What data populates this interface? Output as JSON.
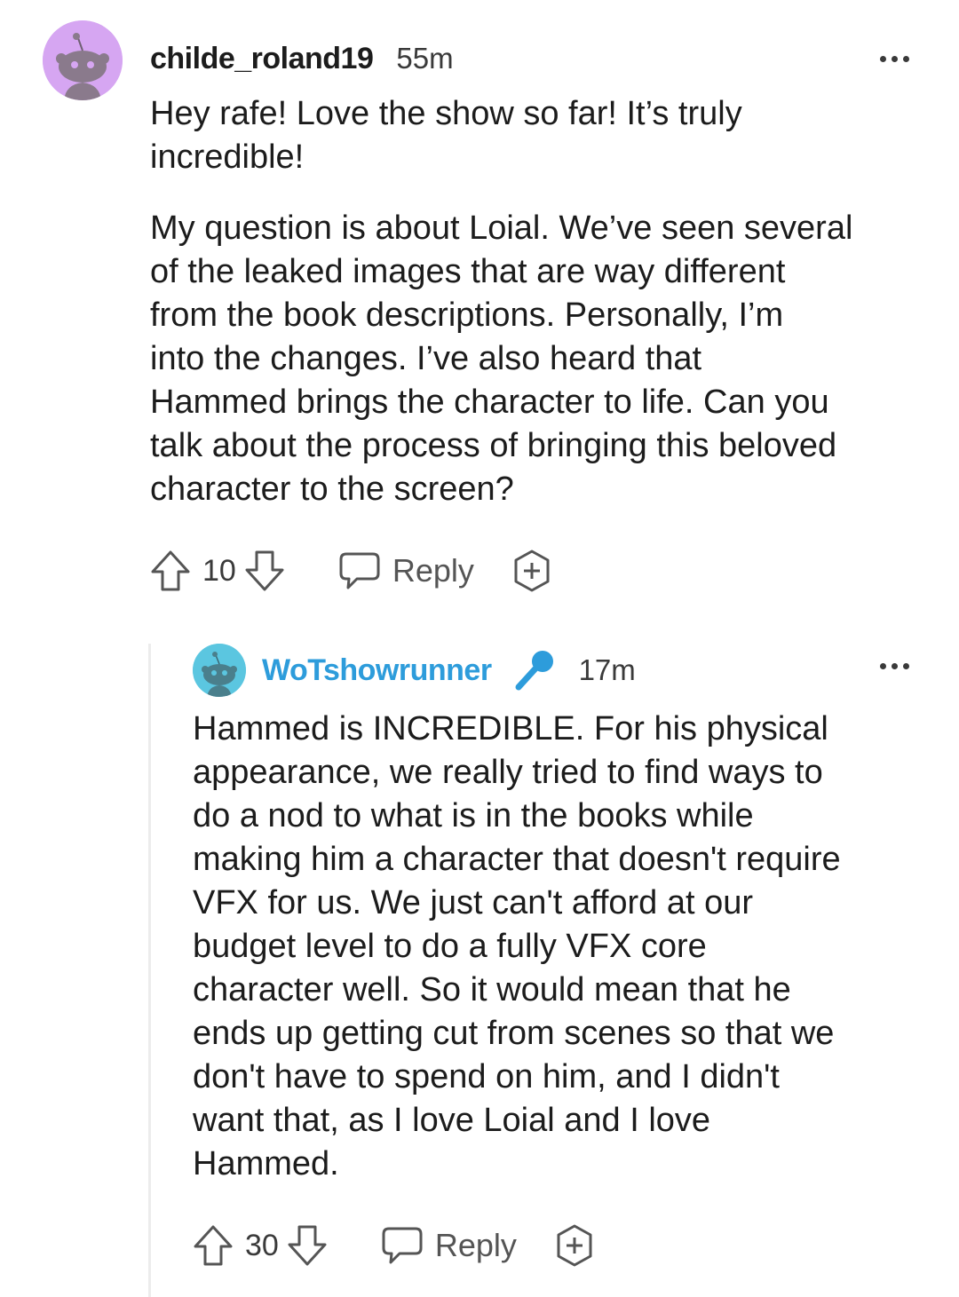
{
  "comments": [
    {
      "username": "childe_roland19",
      "time": "55m",
      "paragraphs": [
        [
          "Hey rafe! Love the show so far! It’s truly",
          "incredible!"
        ],
        [
          "My question is about Loial. We’ve seen several",
          "of the leaked images that are way different",
          "from the book descriptions. Personally, I’m",
          "into the changes. I’ve also heard that",
          "Hammed brings the character to life. Can you",
          "talk about the process of bringing this beloved",
          "character to the screen?"
        ]
      ],
      "votes": "10",
      "reply_label": "Reply",
      "avatar_color": "#D6A6F2"
    },
    {
      "username": "WoTshowrunner",
      "time": "17m",
      "username_color": "#2D9CDB",
      "lines": [
        "Hammed is INCREDIBLE. For his physical",
        "appearance, we really tried to find ways to",
        "do a nod to what is in the books while",
        "making him a character that doesn't require",
        "VFX for us. We just can't afford at our",
        "budget level to do a fully VFX core",
        "character well. So it would mean that he",
        "ends up getting cut from scenes so that we",
        "don't have to spend on him, and I didn't",
        "want that, as I love Loial and I love",
        "Hammed."
      ],
      "votes": "30",
      "reply_label": "Reply",
      "avatar_color": "#5BC6E0"
    }
  ],
  "icons": {
    "upvote": "arrow-up-icon",
    "downvote": "arrow-down-icon",
    "reply": "speech-bubble-icon",
    "award": "award-plus-icon",
    "more": "more-dots-icon",
    "flair": "microphone-icon"
  }
}
